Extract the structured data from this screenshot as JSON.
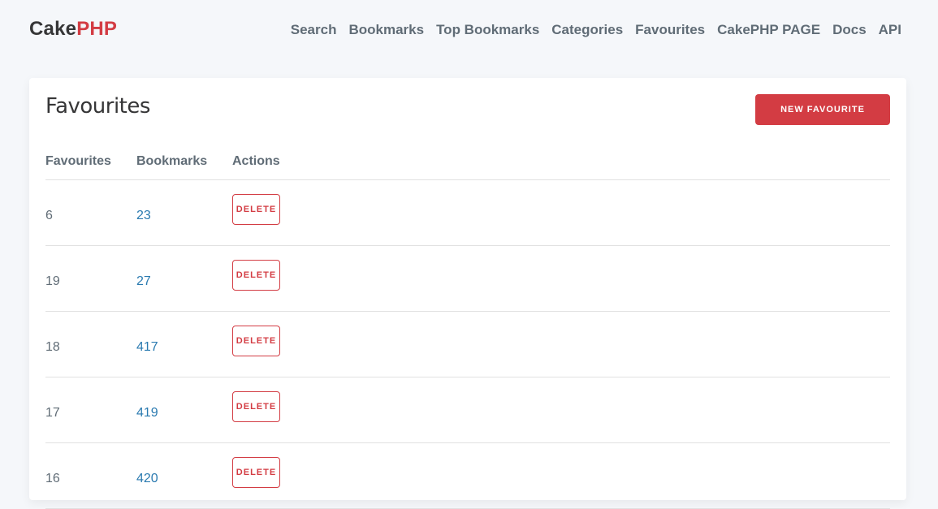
{
  "brand": {
    "part1": "Cake",
    "part2": "PHP"
  },
  "nav": [
    "Search",
    "Bookmarks",
    "Top Bookmarks",
    "Categories",
    "Favourites",
    "CakePHP PAGE",
    "Docs",
    "API"
  ],
  "page": {
    "title": "Favourites",
    "new_button_label": "NEW FAVOURITE"
  },
  "table": {
    "headers": [
      "Favourites",
      "Bookmarks",
      "Actions"
    ],
    "rows": [
      {
        "favourite": "6",
        "bookmark": "23",
        "action": "DELETE"
      },
      {
        "favourite": "19",
        "bookmark": "27",
        "action": "DELETE"
      },
      {
        "favourite": "18",
        "bookmark": "417",
        "action": "DELETE"
      },
      {
        "favourite": "17",
        "bookmark": "419",
        "action": "DELETE"
      },
      {
        "favourite": "16",
        "bookmark": "420",
        "action": "DELETE"
      }
    ]
  },
  "colors": {
    "brand_red": "#d33c43",
    "link_blue": "#2a7ab0",
    "text_gray": "#606c76",
    "background": "#f5f7fa"
  }
}
